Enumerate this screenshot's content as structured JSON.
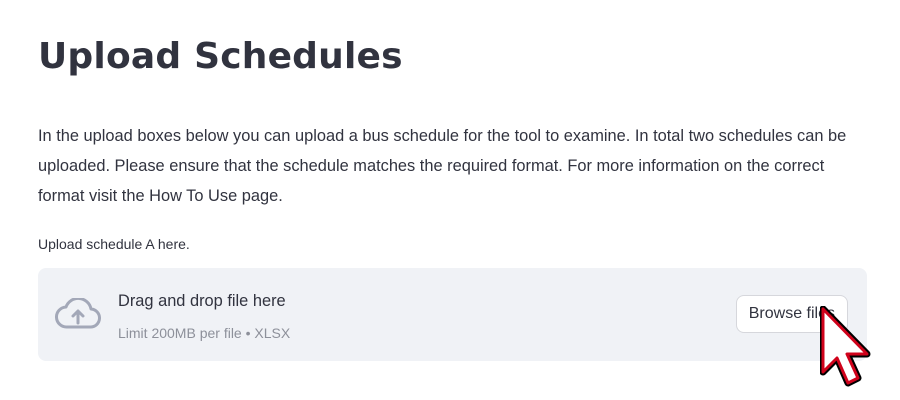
{
  "page": {
    "title": "Upload Schedules",
    "intro": "In the upload boxes below you can upload a bus schedule for the tool to examine. In total two schedules can be uploaded. Please ensure that the schedule matches the required format. For more information on the correct format visit the How To Use page."
  },
  "uploader_a": {
    "label": "Upload schedule A here.",
    "dropzone_title": "Drag and drop file here",
    "dropzone_limit": "Limit 200MB per file • XLSX",
    "browse_label": "Browse files",
    "icon": "cloud-upload-icon"
  },
  "colors": {
    "text": "#31333f",
    "muted_text": "#8d909a",
    "dropzone_bg": "#f0f2f6",
    "icon": "#a3a8b8",
    "cursor_outline": "#d0021b"
  }
}
